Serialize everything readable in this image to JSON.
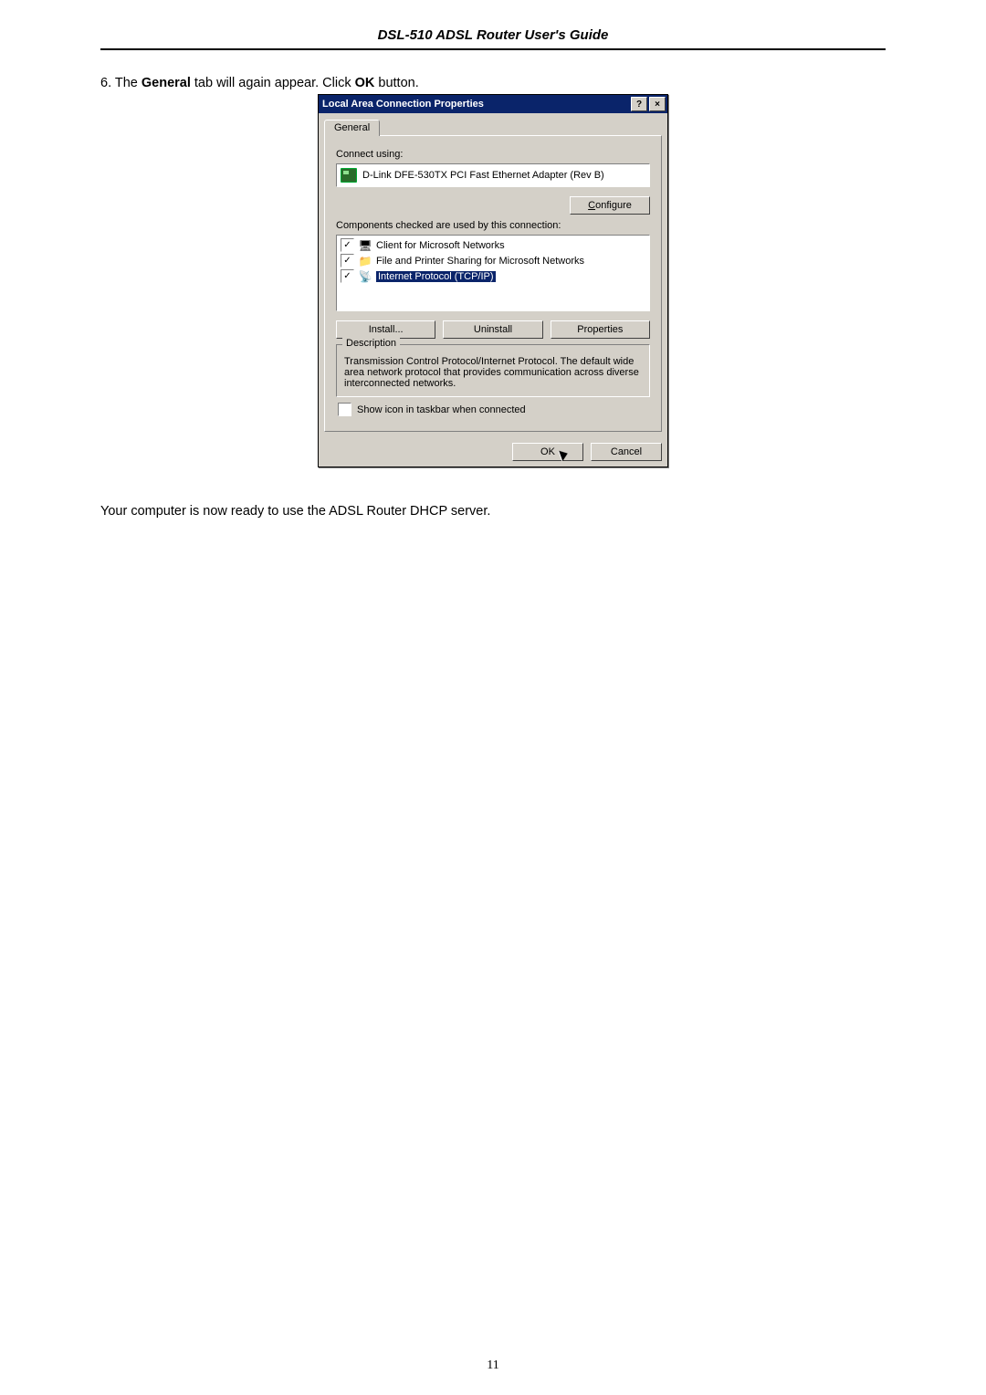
{
  "header": {
    "title": "DSL-510 ADSL Router User's Guide"
  },
  "instruction": {
    "prefix": "6. The ",
    "bold1": "General",
    "mid": " tab will again appear. Click ",
    "bold2": "OK",
    "suffix": " button."
  },
  "dialog": {
    "title": "Local Area Connection Properties",
    "help_glyph": "?",
    "close_glyph": "×",
    "tab_general": "General",
    "connect_using_label": "Connect using:",
    "adapter": "D-Link DFE-530TX PCI Fast Ethernet Adapter (Rev B)",
    "configure_btn": "Configure",
    "components_label": "Components checked are used by this connection:",
    "components": [
      {
        "label": "Client for Microsoft Networks",
        "checked": true,
        "icon": "🖥",
        "selected": false
      },
      {
        "label": "File and Printer Sharing for Microsoft Networks",
        "checked": true,
        "icon": "📁",
        "selected": false
      },
      {
        "label": "Internet Protocol (TCP/IP)",
        "checked": true,
        "icon": "📡",
        "selected": true
      }
    ],
    "install_btn": "Install...",
    "uninstall_btn": "Uninstall",
    "properties_btn": "Properties",
    "description_legend": "Description",
    "description_text": "Transmission Control Protocol/Internet Protocol. The default wide area network protocol that provides communication across diverse interconnected networks.",
    "show_icon_label": "Show icon in taskbar when connected",
    "ok_btn": "OK",
    "cancel_btn": "Cancel"
  },
  "after_text": "Your computer is now ready to use the ADSL Router DHCP server.",
  "page_number": "11"
}
